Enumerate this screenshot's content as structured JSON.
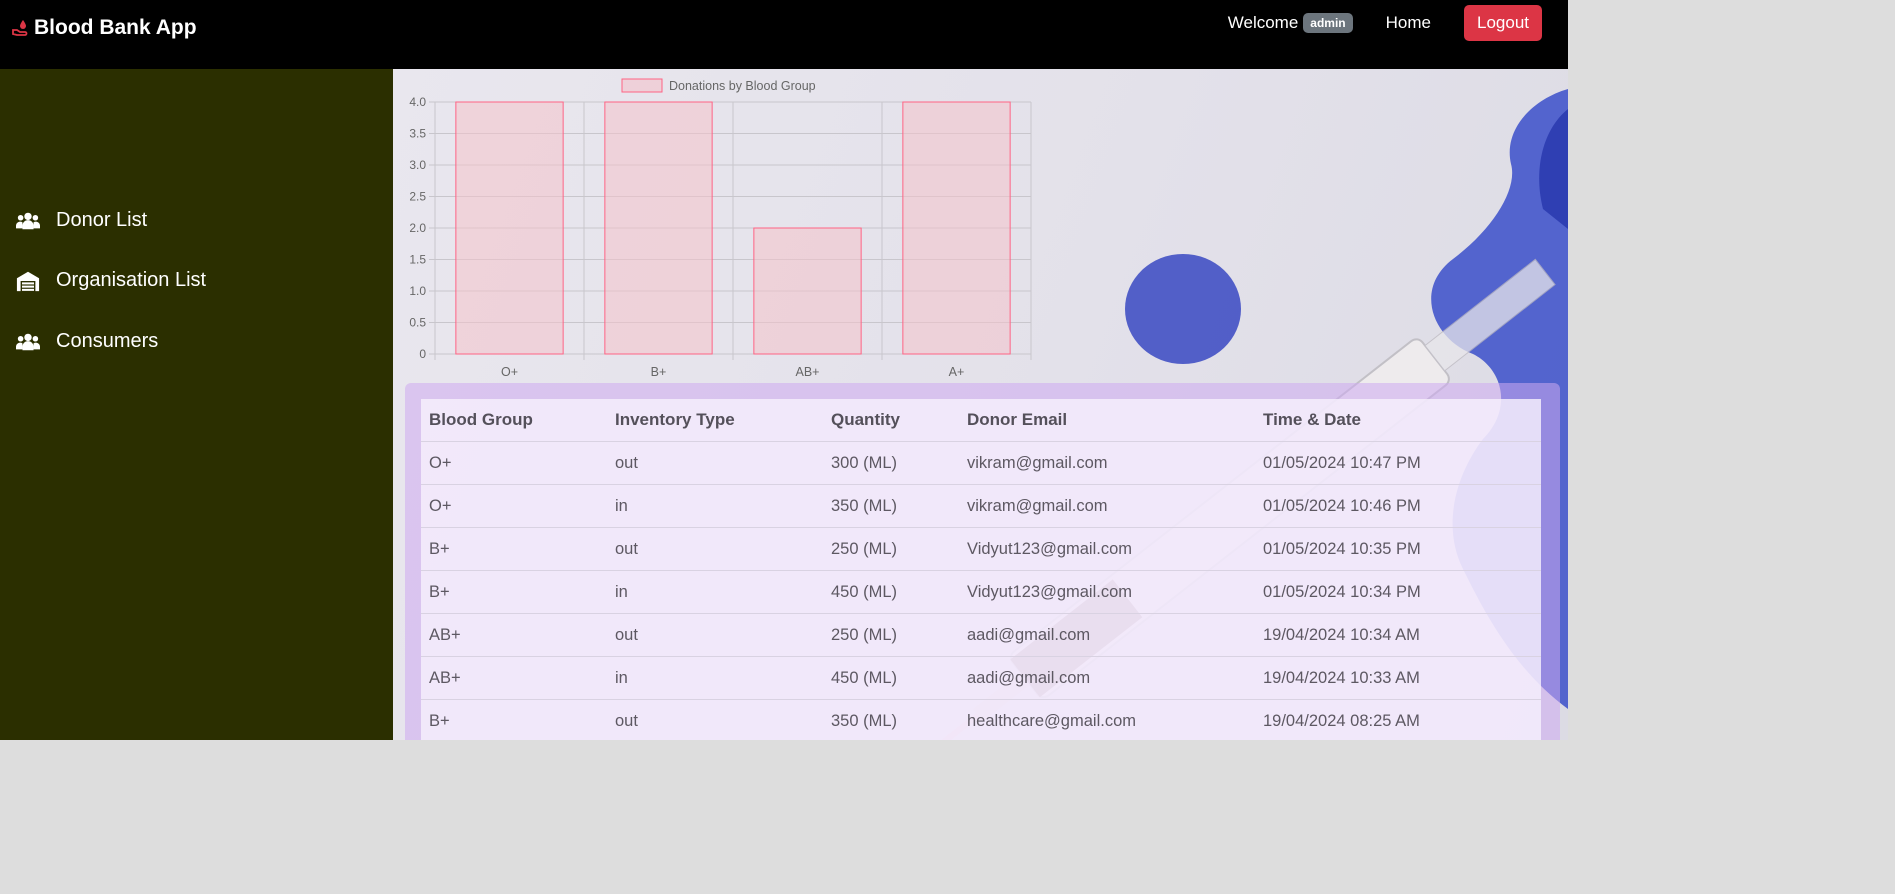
{
  "brand": {
    "title": "Blood Bank App",
    "icon": "hand-blood-drop-icon"
  },
  "nav": {
    "welcome": "Welcome",
    "role": "admin",
    "home": "Home",
    "logout": "Logout"
  },
  "sidebar": {
    "items": [
      {
        "label": "Donor List",
        "icon": "users-icon"
      },
      {
        "label": "Organisation List",
        "icon": "warehouse-icon"
      },
      {
        "label": "Consumers",
        "icon": "users-icon"
      }
    ]
  },
  "colors": {
    "topbar": "#000000",
    "sidebar": "#2b2f00",
    "logout": "#dc3545",
    "bar_fill": "#f4c2cb",
    "bar_stroke": "#ff6384"
  },
  "chart_data": {
    "type": "bar",
    "categories": [
      "O+",
      "B+",
      "AB+",
      "A+"
    ],
    "series": [
      {
        "name": "Donations by Blood Group",
        "values": [
          4,
          4,
          2,
          4
        ]
      }
    ],
    "ylim": [
      0,
      4
    ],
    "yticks": [
      "0",
      "0.5",
      "1.0",
      "1.5",
      "2.0",
      "2.5",
      "3.0",
      "3.5",
      "4.0"
    ],
    "legend": "top",
    "grid": true
  },
  "table": {
    "headers": [
      "Blood Group",
      "Inventory Type",
      "Quantity",
      "Donor Email",
      "Time & Date"
    ],
    "rows": [
      [
        "O+",
        "out",
        "300 (ML)",
        "vikram@gmail.com",
        "01/05/2024 10:47 PM"
      ],
      [
        "O+",
        "in",
        "350 (ML)",
        "vikram@gmail.com",
        "01/05/2024 10:46 PM"
      ],
      [
        "B+",
        "out",
        "250 (ML)",
        "Vidyut123@gmail.com",
        "01/05/2024 10:35 PM"
      ],
      [
        "B+",
        "in",
        "450 (ML)",
        "Vidyut123@gmail.com",
        "01/05/2024 10:34 PM"
      ],
      [
        "AB+",
        "out",
        "250 (ML)",
        "aadi@gmail.com",
        "19/04/2024 10:34 AM"
      ],
      [
        "AB+",
        "in",
        "450 (ML)",
        "aadi@gmail.com",
        "19/04/2024 10:33 AM"
      ],
      [
        "B+",
        "out",
        "350 (ML)",
        "healthcare@gmail.com",
        "19/04/2024 08:25 AM"
      ]
    ]
  }
}
